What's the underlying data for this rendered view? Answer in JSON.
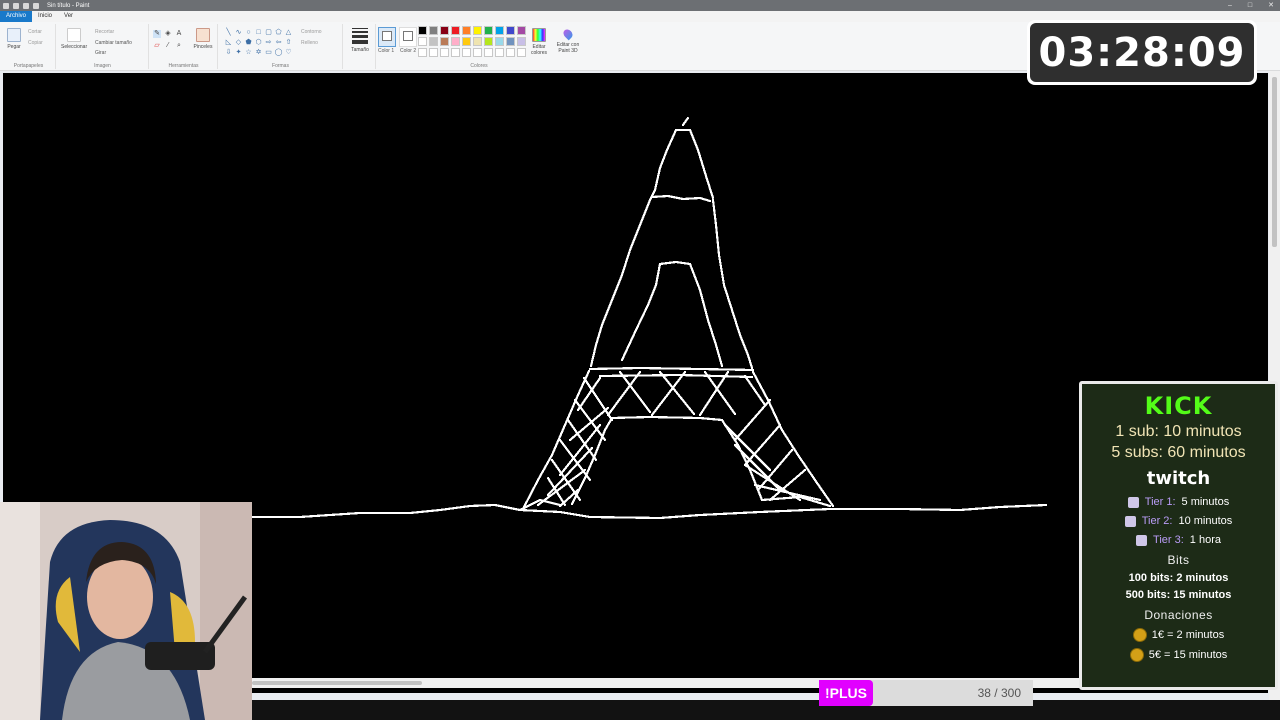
{
  "window": {
    "title": "Sin título - Paint",
    "controls": [
      "–",
      "□",
      "✕"
    ]
  },
  "tabs": [
    "Archivo",
    "Inicio",
    "Ver"
  ],
  "ribbon": {
    "groups": {
      "portapapeles": "Portapapeles",
      "imagen": "Imagen",
      "herramientas": "Herramientas",
      "formas": "Formas",
      "colores": "Colores"
    },
    "pegar": "Pegar",
    "cortar": "Cortar",
    "copiar": "Copiar",
    "seleccionar": "Seleccionar",
    "recortar": "Recortar",
    "cambiar_tamano": "Cambiar tamaño",
    "girar": "Girar",
    "pinceles": "Pinceles",
    "contorno": "Contorno",
    "relleno": "Relleno",
    "tamano": "Tamaño",
    "color1": "Color 1",
    "color2": "Color 2",
    "editar_colores": "Editar colores",
    "editar_paint3d": "Editar con Paint 3D",
    "palette": [
      "#000000",
      "#7f7f7f",
      "#880015",
      "#ed1c24",
      "#ff7f27",
      "#fff200",
      "#22b14c",
      "#00a2e8",
      "#3f48cc",
      "#a349a4",
      "#ffffff",
      "#c3c3c3",
      "#b97a57",
      "#ffaec9",
      "#ffc90e",
      "#efe4b0",
      "#b5e61d",
      "#99d9ea",
      "#7092be",
      "#c8bfe7",
      "#ffffff",
      "#ffffff",
      "#ffffff",
      "#ffffff",
      "#ffffff",
      "#ffffff",
      "#ffffff",
      "#ffffff",
      "#ffffff",
      "#ffffff"
    ]
  },
  "timer": "03:28:09",
  "subs": {
    "kick": "KICK",
    "kick_1": "1 sub: 10 minutos",
    "kick_5": "5 subs: 60 minutos",
    "twitch": "twitch",
    "tiers": [
      {
        "name": "Tier 1:",
        "value": "5 minutos"
      },
      {
        "name": "Tier 2:",
        "value": "10 minutos"
      },
      {
        "name": "Tier 3:",
        "value": "1 hora"
      }
    ],
    "bits_header": "Bits",
    "bits": [
      "100 bits: 2 minutos",
      "500 bits: 15 minutos"
    ],
    "donaciones_header": "Donaciones",
    "donaciones": [
      "1€ = 2 minutos",
      "5€ = 15 minutos"
    ]
  },
  "plus": {
    "label": "!PLUS",
    "count": "38 / 300",
    "progress": 0.127
  }
}
